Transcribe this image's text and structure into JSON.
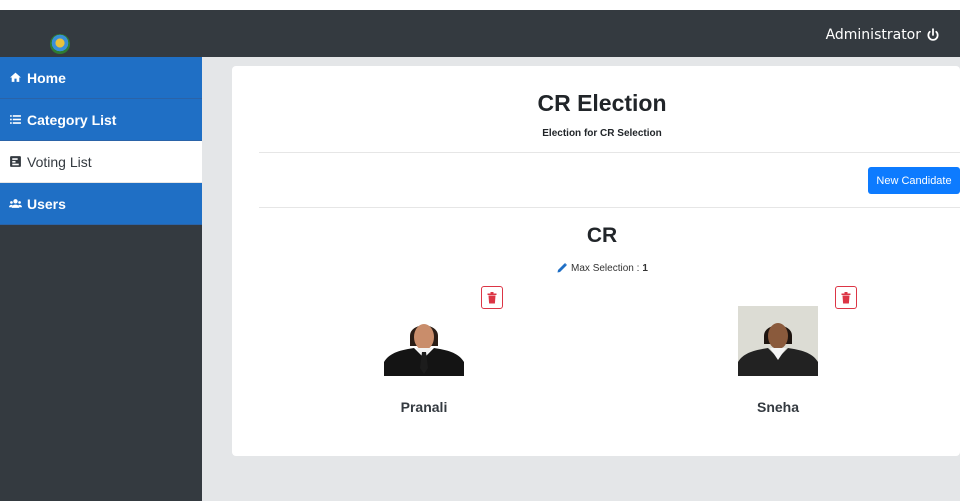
{
  "header": {
    "user": "Administrator",
    "logo": "college-emblem",
    "power_icon": "power-icon"
  },
  "sidebar": {
    "items": [
      {
        "label": "Home",
        "icon": "home-icon",
        "active": false
      },
      {
        "label": "Category List",
        "icon": "list-icon",
        "active": false
      },
      {
        "label": "Voting List",
        "icon": "poll-icon",
        "active": true
      },
      {
        "label": "Users",
        "icon": "users-icon",
        "active": false
      }
    ]
  },
  "election": {
    "title": "CR Election",
    "description": "Election for CR Selection"
  },
  "actions": {
    "new_candidate": "New Candidate"
  },
  "category": {
    "name": "CR",
    "max_label": "Max Selection :",
    "max_value": "1"
  },
  "candidates": [
    {
      "name": "Pranali"
    },
    {
      "name": "Sneha"
    }
  ],
  "colors": {
    "primary": "#1f6fc5",
    "sidebar_bg": "#343a40",
    "danger": "#dc3545",
    "button": "#0d7bff"
  }
}
